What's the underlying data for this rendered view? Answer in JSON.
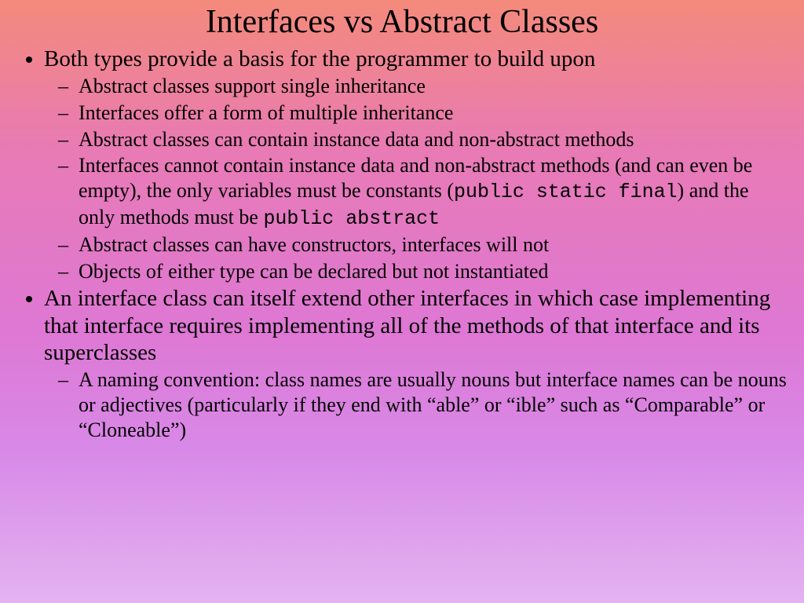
{
  "title": "Interfaces vs Abstract Classes",
  "bullets": {
    "b1": "Both types provide a basis for the programmer to build upon",
    "b1_1": "Abstract classes support single inheritance",
    "b1_2": "Interfaces offer a form of multiple inheritance",
    "b1_3": "Abstract classes can contain instance data and non-abstract methods",
    "b1_4a": "Interfaces cannot contain instance data and non-abstract methods (and can even be empty), the only variables must be constants (",
    "b1_4code1": "public static final",
    "b1_4b": ") and the only methods must be ",
    "b1_4code2": "public abstract",
    "b1_5": "Abstract classes can have constructors, interfaces will not",
    "b1_6": "Objects of either type can be declared but not instantiated",
    "b2": "An interface class can itself extend other interfaces in which case implementing that interface requires implementing all of the methods of that interface and its superclasses",
    "b2_1": "A naming convention:  class names are usually nouns but interface names can be nouns or adjectives (particularly if they end with “able” or “ible” such as “Comparable” or “Cloneable”)"
  }
}
